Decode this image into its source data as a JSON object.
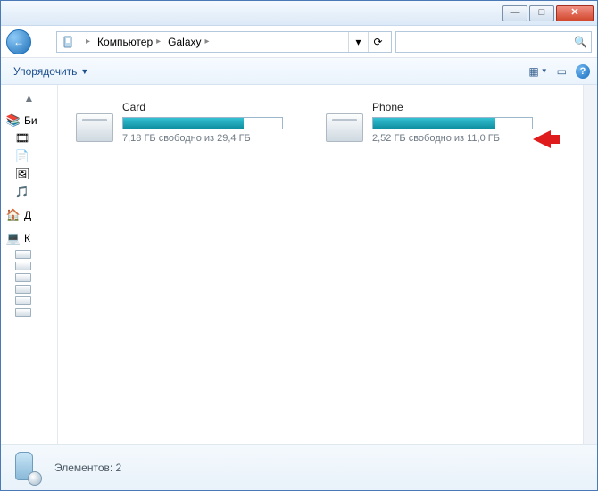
{
  "titlebar": {
    "min": "—",
    "max": "□",
    "close": "✕"
  },
  "nav": {
    "back_glyph": "←",
    "fwd_glyph": "→",
    "refresh_glyph": "⟳",
    "dropdown_glyph": "▾"
  },
  "breadcrumbs": [
    {
      "label": "Компьютер"
    },
    {
      "label": "Galaxy"
    }
  ],
  "search": {
    "placeholder": "",
    "icon_glyph": "🔍"
  },
  "toolbar": {
    "organize_label": "Упорядочить",
    "dropdown_glyph": "▼",
    "view_glyph": "▦",
    "preview_glyph": "▭",
    "help_glyph": "?"
  },
  "sidebar": {
    "scroll_up_glyph": "▲",
    "groups": [
      {
        "label": "Би",
        "items": [
          {
            "icon": "🎞",
            "text": ""
          },
          {
            "icon": "📄",
            "text": ""
          },
          {
            "icon": "🖼",
            "text": ""
          },
          {
            "icon": "🎵",
            "text": ""
          }
        ]
      },
      {
        "label": "Д",
        "icon": "🏠",
        "items": []
      },
      {
        "label": "К",
        "icon": "💻",
        "items": [
          {
            "icon": "drive",
            "text": ""
          },
          {
            "icon": "drive",
            "text": ""
          },
          {
            "icon": "drive",
            "text": ""
          },
          {
            "icon": "drive",
            "text": ""
          },
          {
            "icon": "drive",
            "text": ""
          },
          {
            "icon": "drive",
            "text": ""
          }
        ]
      }
    ]
  },
  "drives": [
    {
      "name": "Card",
      "free_text": "7,18 ГБ свободно из 29,4 ГБ",
      "used_pct": 76
    },
    {
      "name": "Phone",
      "free_text": "2,52 ГБ свободно из 11,0 ГБ",
      "used_pct": 77
    }
  ],
  "statusbar": {
    "text": "Элементов: 2"
  }
}
